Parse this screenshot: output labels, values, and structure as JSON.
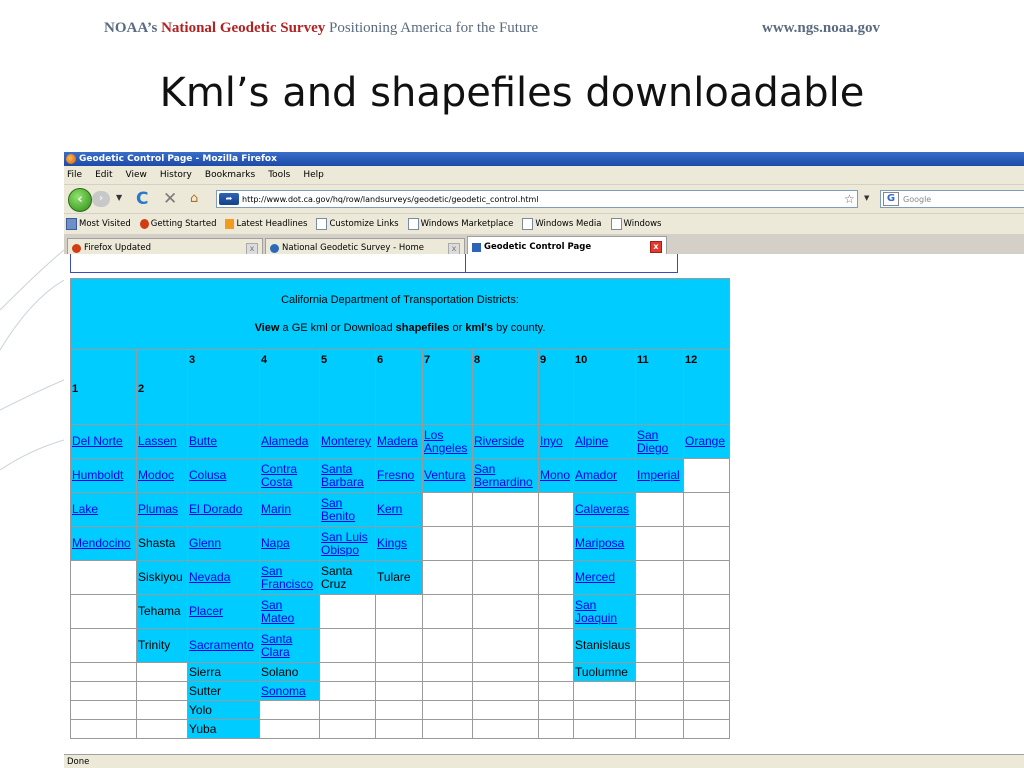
{
  "slide": {
    "header_org": "NOAA’s",
    "header_ngs": "National Geodetic Survey",
    "header_tagline": "Positioning America for the Future",
    "header_url": "www.ngs.noaa.gov",
    "title": "Kml’s and shapefiles downloadable"
  },
  "browser": {
    "window_title": "Geodetic Control Page - Mozilla Firefox",
    "menu": [
      "File",
      "Edit",
      "View",
      "History",
      "Bookmarks",
      "Tools",
      "Help"
    ],
    "url": "http://www.dot.ca.gov/hq/row/landsurveys/geodetic/geodetic_control.html",
    "search_placeholder": "Google",
    "bookmarks": [
      {
        "label": "Most Visited",
        "icon": "folder-icon"
      },
      {
        "label": "Getting Started",
        "icon": "firefox-icon"
      },
      {
        "label": "Latest Headlines",
        "icon": "rss-icon"
      },
      {
        "label": "Customize Links",
        "icon": "page-icon"
      },
      {
        "label": "Windows Marketplace",
        "icon": "page-icon"
      },
      {
        "label": "Windows Media",
        "icon": "page-icon"
      },
      {
        "label": "Windows",
        "icon": "page-icon"
      }
    ],
    "tabs": [
      {
        "label": "Firefox Updated",
        "active": false
      },
      {
        "label": "National Geodetic Survey - Home",
        "active": false
      },
      {
        "label": "Geodetic Control Page",
        "active": true
      }
    ],
    "status": "Done"
  },
  "page": {
    "caption_line1": "California Department of Transportation Districts:",
    "caption_view": "View",
    "caption_mid1": " a GE kml or Download ",
    "caption_shapefiles": "shapefiles",
    "caption_or": " or ",
    "caption_kmls": "kml's",
    "caption_end": " by county.",
    "districts": [
      "1",
      "2",
      "3",
      "4",
      "5",
      "6",
      "7",
      "8",
      "9",
      "10",
      "11",
      "12"
    ],
    "counties": {
      "d1": [
        "Del Norte",
        "Humboldt",
        "Lake",
        "Mendocino"
      ],
      "d2": [
        "Lassen",
        "Modoc",
        "Plumas",
        "Shasta",
        "Siskiyou",
        "Tehama",
        "Trinity"
      ],
      "d3": [
        "Butte",
        "Colusa",
        "El Dorado",
        "Glenn",
        "Nevada",
        "Placer",
        "Sacramento",
        "Sierra",
        "Sutter",
        "Yolo",
        "Yuba"
      ],
      "d4": [
        "Alameda",
        "Contra Costa",
        "Marin",
        "Napa",
        "San Francisco",
        "San Mateo",
        "Santa Clara",
        "Solano",
        "Sonoma"
      ],
      "d5": [
        "Monterey",
        "Santa Barbara",
        "San Benito",
        "San Luis Obispo",
        "Santa Cruz"
      ],
      "d6": [
        "Madera",
        "Fresno",
        "Kern",
        "Kings",
        "Tulare"
      ],
      "d7": [
        "Los Angeles",
        "Ventura"
      ],
      "d8": [
        "Riverside",
        "San Bernardino"
      ],
      "d9": [
        "Inyo",
        "Mono"
      ],
      "d10": [
        "Alpine",
        "Amador",
        "Calaveras",
        "Mariposa",
        "Merced",
        "San Joaquin",
        "Stanislaus",
        "Tuolumne"
      ],
      "d11": [
        "San Diego",
        "Imperial"
      ],
      "d12": [
        "Orange"
      ]
    }
  }
}
